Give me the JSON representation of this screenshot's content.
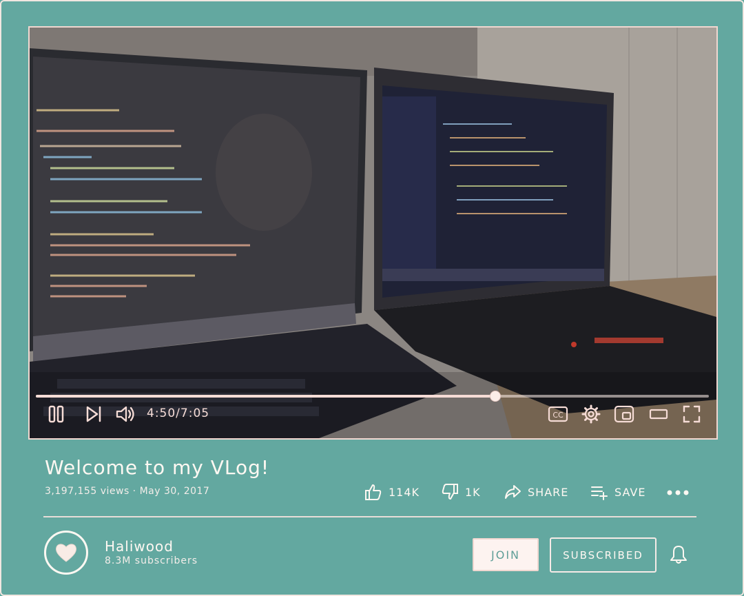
{
  "video": {
    "time_current": "4:50",
    "time_total": "7:05",
    "time_display": "4:50/7:05",
    "progress_fraction": 0.682,
    "controls": {
      "pause_icon": "pause-icon",
      "next_icon": "next-icon",
      "volume_icon": "volume-icon",
      "captions_icon": "captions-icon",
      "settings_icon": "gear-icon",
      "miniplayer_icon": "miniplayer-icon",
      "theater_icon": "theater-icon",
      "fullscreen_icon": "fullscreen-icon"
    }
  },
  "info": {
    "title": "Welcome to my VLog!",
    "meta": "3,197,155 views · May 30, 2017",
    "likes": "114K",
    "dislikes": "1K",
    "share_label": "SHARE",
    "save_label": "SAVE"
  },
  "channel": {
    "name": "Haliwood",
    "subscribers": "8.3M subscribers",
    "join_label": "JOIN",
    "subscribed_label": "SUBSCRIBED"
  },
  "colors": {
    "background": "#63a8a0",
    "accent_pink": "#f6dcd6",
    "text_light": "#fff8f2"
  }
}
